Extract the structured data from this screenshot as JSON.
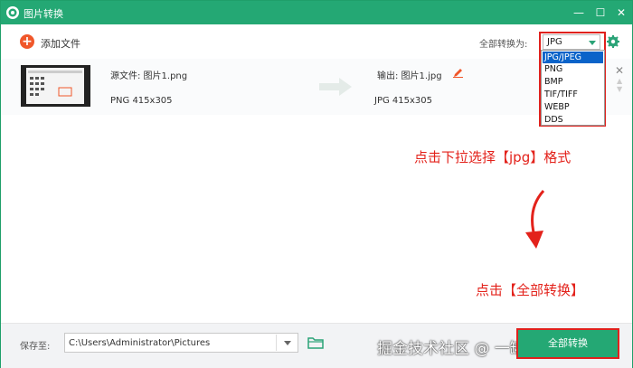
{
  "window": {
    "title": "图片转换",
    "minimize_glyph": "—",
    "maximize_glyph": "☐",
    "close_glyph": "✕"
  },
  "toolbar": {
    "add_label": "添加文件",
    "add_icon_glyph": "+",
    "convert_all_label": "全部转换为:",
    "format_value": "JPG",
    "accent_color": "#24a874"
  },
  "format_dropdown": {
    "options": [
      "JPG/JPEG",
      "PNG",
      "BMP",
      "TIF/TIFF",
      "WEBP",
      "DDS"
    ],
    "selected": "JPG/JPEG"
  },
  "file": {
    "source_name": "源文件: 图片1.png",
    "source_info": "PNG  415x305",
    "output_name": "输出: 图片1.jpg",
    "output_info": "JPG  415x305",
    "remove_glyph": "✕",
    "move_up_glyph": "▲",
    "move_down_glyph": "▼"
  },
  "annotations": {
    "step1": "点击下拉选择【jpg】格式",
    "step2": "点击【全部转换】",
    "color": "#e3221b"
  },
  "bottom": {
    "save_label": "保存至:",
    "save_path": "C:\\Users\\Administrator\\Pictures",
    "convert_button_label": "全部转换",
    "watermark": "掘金技术社区 @ 一罐小可乐"
  },
  "icons": {
    "app": "converter-app-icon",
    "add": "add-circle-icon",
    "settings": "gear-icon",
    "arrow": "right-arrow-icon",
    "edit": "pencil-icon",
    "folder": "folder-icon"
  }
}
